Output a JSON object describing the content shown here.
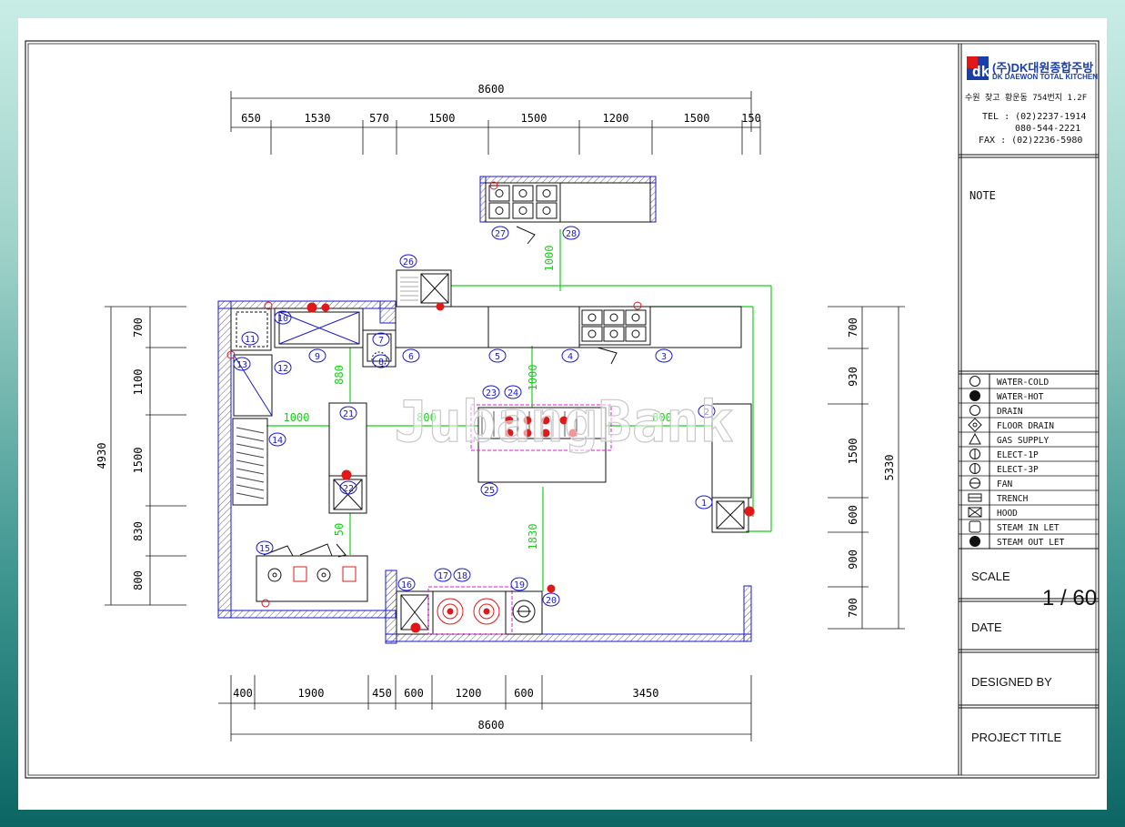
{
  "overall_dimensions": {
    "top": "8600",
    "bottom": "8600",
    "left": "4930",
    "right": "5330"
  },
  "top_dims": [
    "650",
    "1530",
    "570",
    "1500",
    "1500",
    "1200",
    "1500",
    "150"
  ],
  "bottom_dims": [
    "400",
    "1900",
    "450",
    "600",
    "1200",
    "600",
    "3450"
  ],
  "left_dims": [
    "700",
    "1100",
    "1500",
    "830",
    "800"
  ],
  "right_dims": [
    "700",
    "930",
    "1500",
    "600",
    "900",
    "700"
  ],
  "inner_dims": {
    "d1": "1000",
    "d2": "1000",
    "d3": "880",
    "d4": "1000",
    "d5": "800",
    "d6": "800",
    "d7": "1830",
    "d8": "50"
  },
  "item_numbers": [
    "1",
    "2",
    "3",
    "4",
    "5",
    "6",
    "7",
    "8",
    "9",
    "10",
    "11",
    "12",
    "13",
    "14",
    "15",
    "16",
    "17",
    "18",
    "19",
    "20",
    "21",
    "22",
    "23",
    "24",
    "25",
    "26",
    "27",
    "28"
  ],
  "title_block": {
    "company_kr": "(주)DK대원종합주방",
    "company_en": "DK DAEWON TOTAL KITCHEN",
    "address": "수원 찾고 황운동 754번지 1.2F",
    "tel": "TEL : (02)2237-1914",
    "tel2": "080-544-2221",
    "fax": "FAX : (02)2236-5980",
    "note_label": "NOTE",
    "scale_label": "SCALE",
    "scale_value": "1 / 60",
    "date_label": "DATE",
    "designed_label": "DESIGNED BY",
    "project_label": "PROJECT TITLE"
  },
  "legend": [
    {
      "icon": "water-cold-icon",
      "label": "WATER-COLD"
    },
    {
      "icon": "water-hot-icon",
      "label": "WATER-HOT"
    },
    {
      "icon": "drain-icon",
      "label": "DRAIN"
    },
    {
      "icon": "floor-drain-icon",
      "label": "FLOOR DRAIN"
    },
    {
      "icon": "gas-supply-icon",
      "label": "GAS SUPPLY"
    },
    {
      "icon": "elect-1p-icon",
      "label": "ELECT-1P"
    },
    {
      "icon": "elect-3p-icon",
      "label": "ELECT-3P"
    },
    {
      "icon": "fan-icon",
      "label": "FAN"
    },
    {
      "icon": "trench-icon",
      "label": "TRENCH"
    },
    {
      "icon": "hood-icon",
      "label": "HOOD"
    },
    {
      "icon": "steam-inlet-icon",
      "label": "STEAM IN LET"
    },
    {
      "icon": "steam-outlet-icon",
      "label": "STEAM OUT LET"
    }
  ],
  "watermark": "JubangBank",
  "colors": {
    "wall": "#1a1ad0",
    "green": "#18d018",
    "red": "#e01818",
    "magenta": "#e018e0",
    "callout": "#1a1ad0"
  }
}
